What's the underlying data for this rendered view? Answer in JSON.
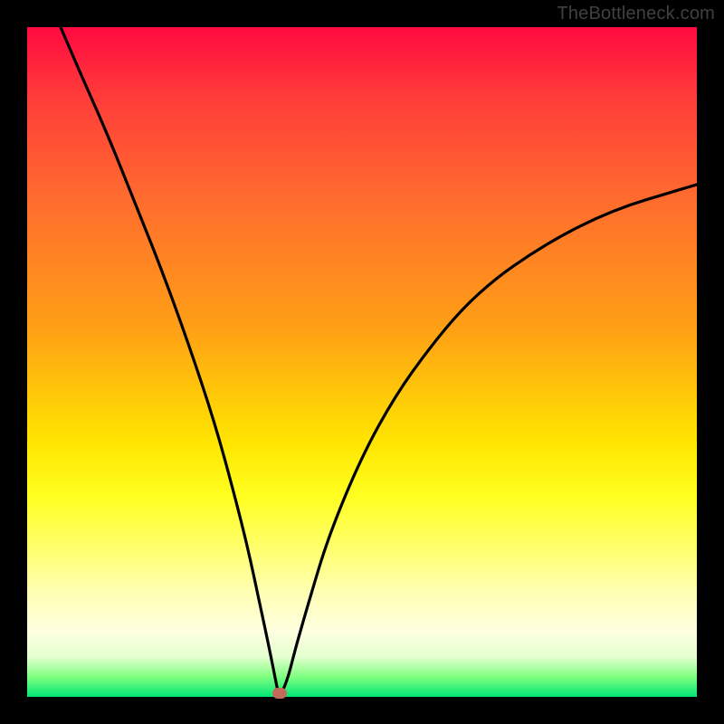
{
  "watermark": "TheBottleneck.com",
  "chart_data": {
    "type": "line",
    "title": "",
    "xlabel": "",
    "ylabel": "",
    "xlim": [
      0,
      100
    ],
    "ylim": [
      0,
      100
    ],
    "series": [
      {
        "name": "curve",
        "x": [
          5,
          8,
          12,
          16,
          20,
          24,
          28,
          31,
          33,
          34.5,
          36,
          37,
          37.5,
          38,
          39,
          40,
          42,
          45,
          50,
          55,
          60,
          65,
          70,
          75,
          80,
          85,
          90,
          95,
          100
        ],
        "y": [
          100,
          93,
          84,
          74,
          64,
          53,
          41,
          30,
          22,
          15,
          8,
          3,
          0.5,
          0.5,
          3,
          7,
          14,
          24,
          36,
          45,
          52,
          58,
          62.5,
          66,
          69,
          71.5,
          73.5,
          75,
          76.5
        ]
      }
    ],
    "marker": {
      "x": 37.7,
      "y": 0.5,
      "color": "#c36b5a"
    },
    "gradient_stops": [
      {
        "pos": 0,
        "color": "#ff0a40"
      },
      {
        "pos": 62,
        "color": "#ffe500"
      },
      {
        "pos": 100,
        "color": "#00e676"
      }
    ]
  }
}
